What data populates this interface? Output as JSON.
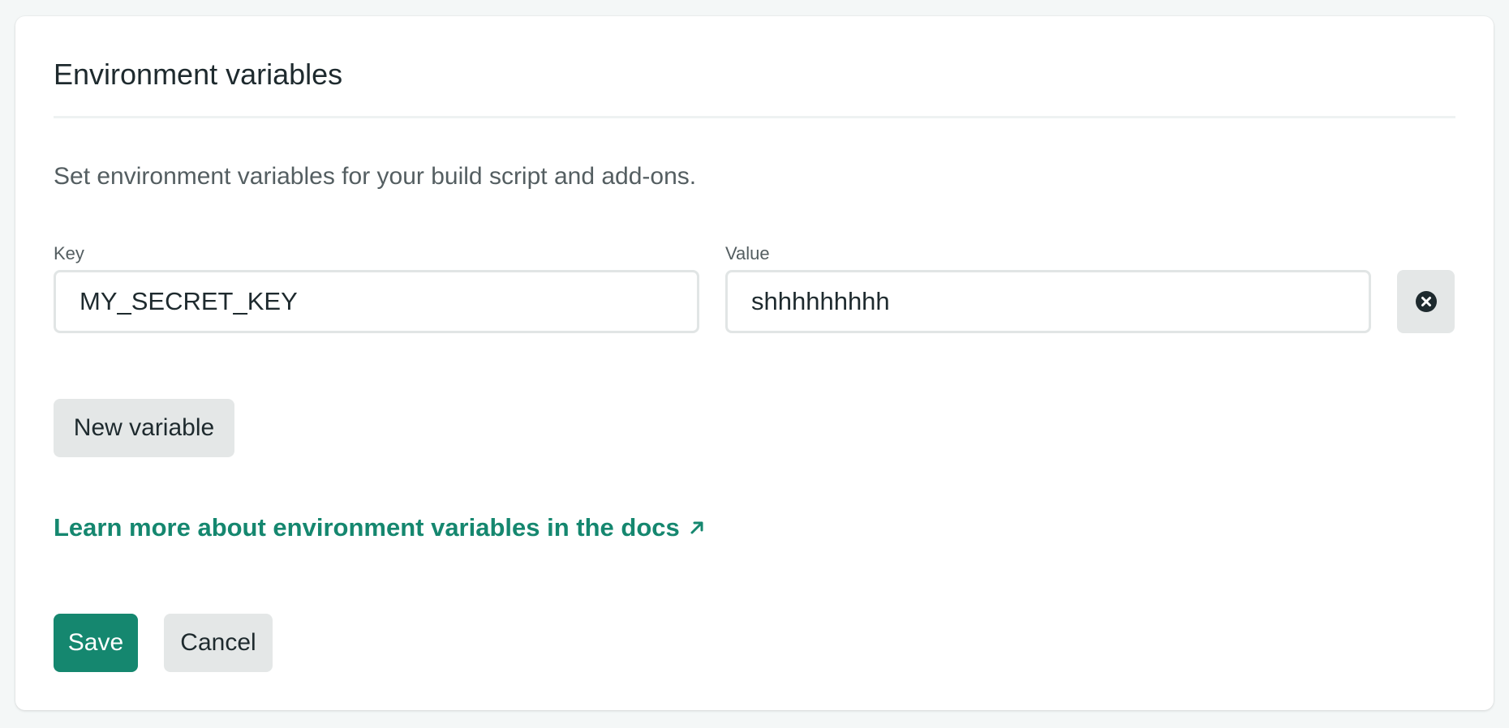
{
  "section": {
    "title": "Environment variables",
    "description": "Set environment variables for your build script and add-ons."
  },
  "variables": [
    {
      "key_label": "Key",
      "key_value": "MY_SECRET_KEY",
      "value_label": "Value",
      "value_value": "shhhhhhhhh"
    }
  ],
  "actions": {
    "new_variable_label": "New variable",
    "docs_link_label": "Learn more about environment variables in the docs",
    "save_label": "Save",
    "cancel_label": "Cancel"
  },
  "icons": {
    "delete": "close-circle-icon",
    "external_link": "arrow-up-right-icon"
  },
  "colors": {
    "accent": "#15876f",
    "secondary_button_bg": "#e4e7e7",
    "text": "#1e2a2e",
    "muted_text": "#545e61"
  }
}
